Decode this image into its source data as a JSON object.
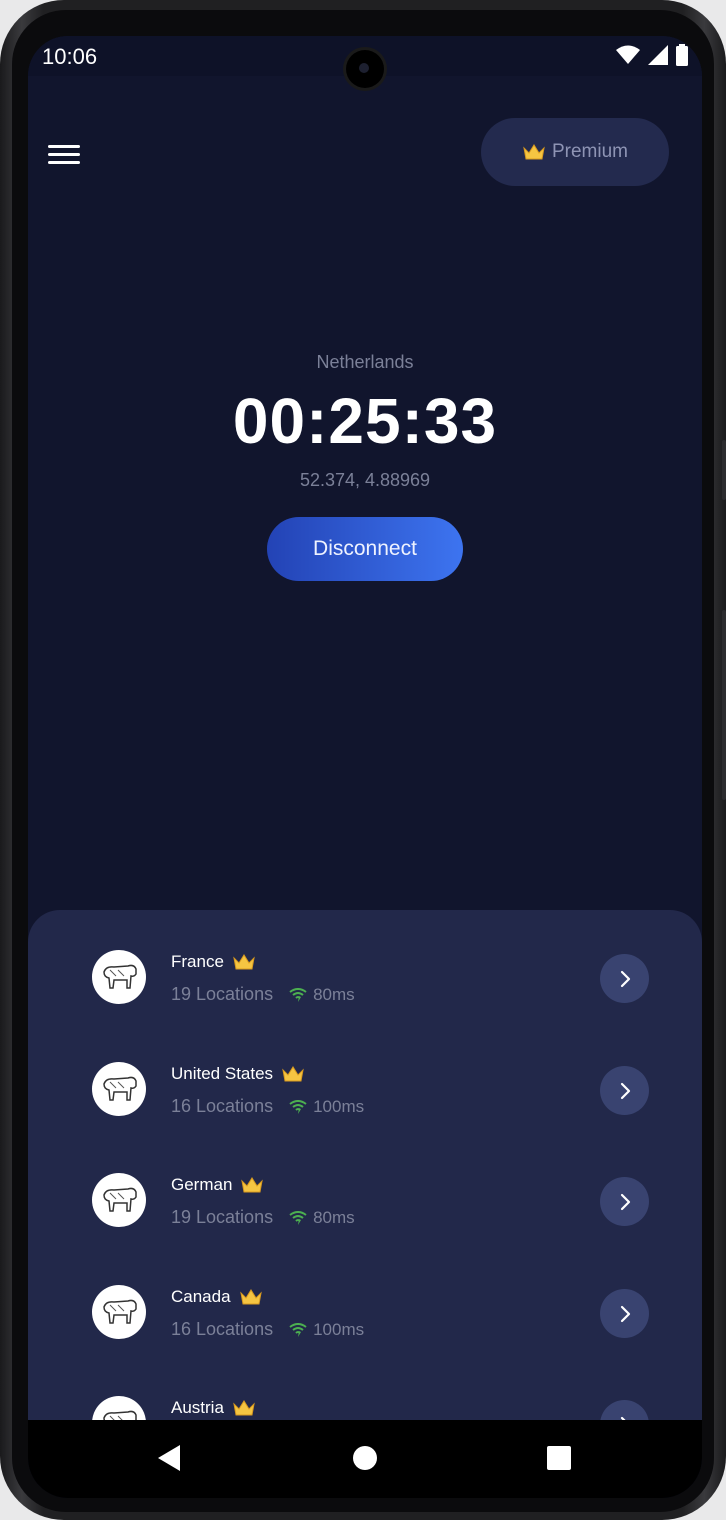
{
  "status_bar": {
    "time": "10:06"
  },
  "header": {
    "premium_label": "Premium"
  },
  "connection": {
    "country": "Netherlands",
    "timer": "00:25:33",
    "coordinates": "52.374, 4.88969",
    "disconnect_label": "Disconnect"
  },
  "servers": [
    {
      "name": "France",
      "locations": "19 Locations",
      "ping": "80ms"
    },
    {
      "name": "United States",
      "locations": "16 Locations",
      "ping": "100ms"
    },
    {
      "name": "German",
      "locations": "19 Locations",
      "ping": "80ms"
    },
    {
      "name": "Canada",
      "locations": "16 Locations",
      "ping": "100ms"
    },
    {
      "name": "Austria",
      "locations": "",
      "ping": ""
    }
  ],
  "colors": {
    "background": "#11152d",
    "panel": "#22284a",
    "accent_start": "#2343b5",
    "accent_end": "#3d74f0",
    "ping_green": "#4caf50",
    "crown_gold": "#f5c542"
  },
  "icons": [
    "menu-icon",
    "crown-icon",
    "wifi-icon",
    "signal-icon",
    "battery-icon",
    "chevron-right-icon",
    "back-icon",
    "home-icon",
    "recents-icon"
  ]
}
